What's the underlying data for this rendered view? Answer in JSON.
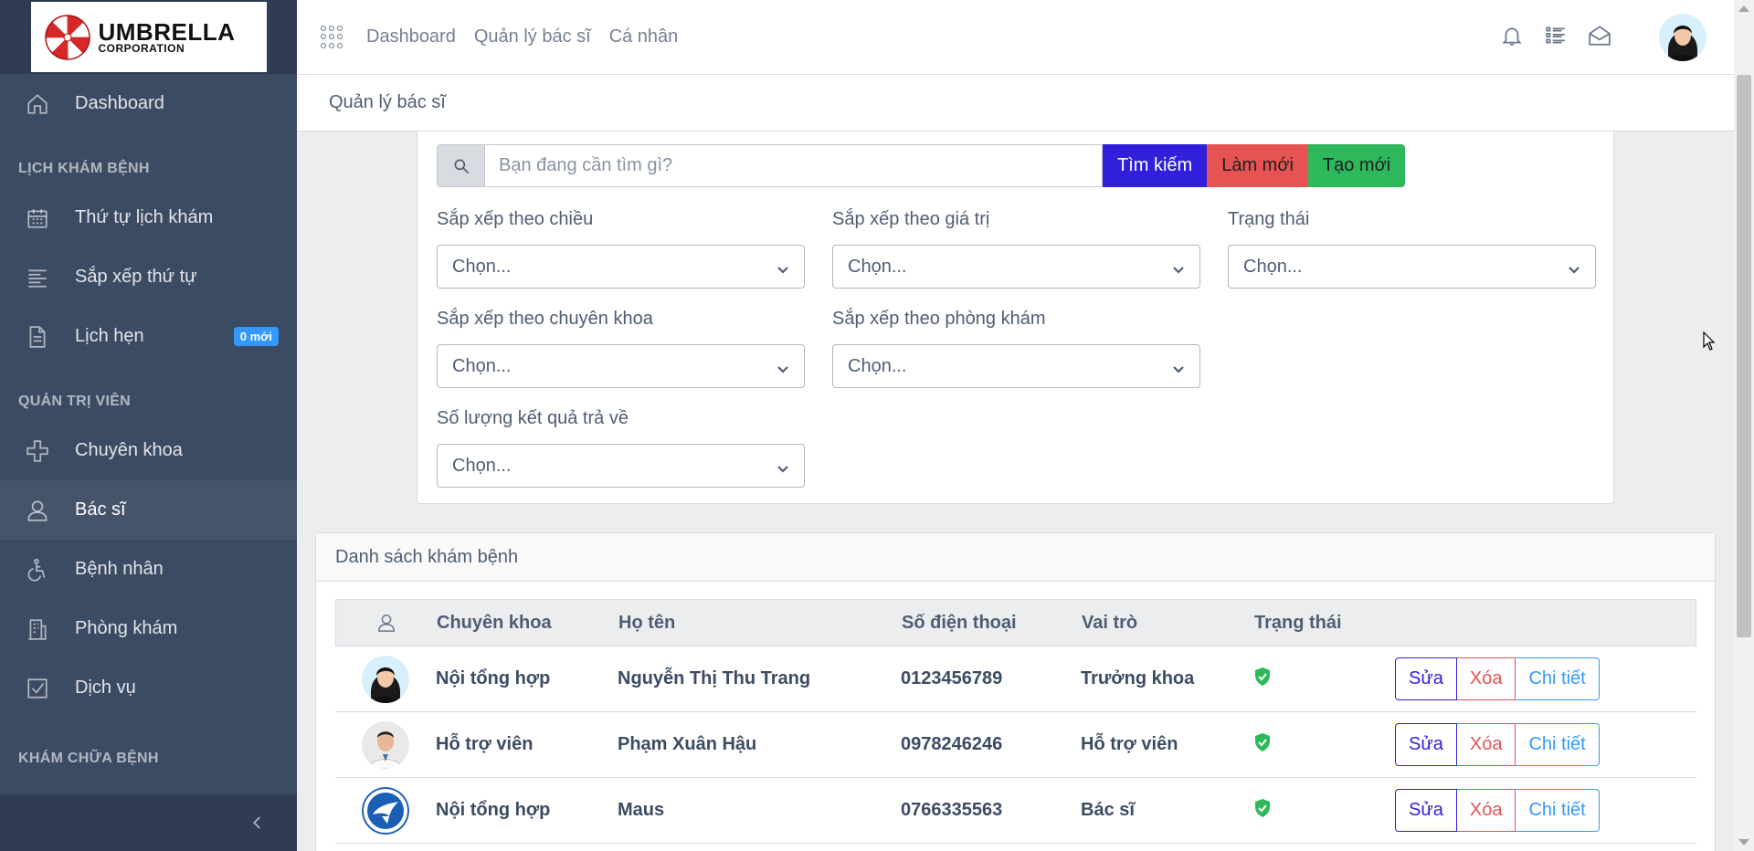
{
  "sidebar": {
    "logo_line1": "UMBRELLA",
    "logo_line2": "CORPORATION",
    "items": [
      {
        "label": "Dashboard",
        "icon": "home-icon"
      },
      {
        "section": "LỊCH KHÁM BỆNH"
      },
      {
        "label": "Thứ tự lịch khám",
        "icon": "calendar-icon"
      },
      {
        "label": "Sắp xếp thứ tự",
        "icon": "align-left-icon"
      },
      {
        "label": "Lịch hẹn",
        "icon": "document-icon",
        "badge": "0 mới"
      },
      {
        "section": "QUẢN TRỊ VIÊN"
      },
      {
        "label": "Chuyên khoa",
        "icon": "plus-icon"
      },
      {
        "label": "Bác sĩ",
        "icon": "people-icon",
        "active": true
      },
      {
        "label": "Bệnh nhân",
        "icon": "wheelchair-icon"
      },
      {
        "label": "Phòng khám",
        "icon": "building-icon"
      },
      {
        "label": "Dịch vụ",
        "icon": "checkbox-icon"
      },
      {
        "section": "KHÁM CHỮA BỆNH"
      }
    ]
  },
  "header": {
    "links": [
      "Dashboard",
      "Quản lý bác sĩ",
      "Cá nhân"
    ],
    "breadcrumb": "Quản lý bác sĩ"
  },
  "filters": {
    "search_placeholder": "Bạn đang cần tìm gì?",
    "btn_search": "Tìm kiếm",
    "btn_reset": "Làm mới",
    "btn_create": "Tạo mới",
    "sort_direction_label": "Sắp xếp theo chiều",
    "sort_value_label": "Sắp xếp theo giá trị",
    "status_label": "Trạng thái",
    "sort_specialty_label": "Sắp xếp theo chuyên khoa",
    "sort_clinic_label": "Sắp xếp theo phòng khám",
    "result_count_label": "Số lượng kết quả trả về",
    "select_placeholder": "Chọn..."
  },
  "table": {
    "title": "Danh sách khám bệnh",
    "columns": [
      "Chuyên khoa",
      "Họ tên",
      "Số điện thoại",
      "Vai trò",
      "Trạng thái"
    ],
    "actions": {
      "edit": "Sửa",
      "delete": "Xóa",
      "detail": "Chi tiết"
    },
    "rows": [
      {
        "specialty": "Nội tổng hợp",
        "name": "Nguyễn Thị Thu Trang",
        "phone": "0123456789",
        "role": "Trưởng khoa",
        "status": "active"
      },
      {
        "specialty": "Hỗ trợ viên",
        "name": "Phạm Xuân Hậu",
        "phone": "0978246246",
        "role": "Hỗ trợ viên",
        "status": "active"
      },
      {
        "specialty": "Nội tổng hợp",
        "name": "Maus",
        "phone": "0766335563",
        "role": "Bác sĩ",
        "status": "active"
      }
    ]
  },
  "colors": {
    "primary": "#321fdb",
    "danger": "#e55353",
    "success": "#2eb85c",
    "info": "#3399ff",
    "sidebar": "#3c4b64"
  }
}
